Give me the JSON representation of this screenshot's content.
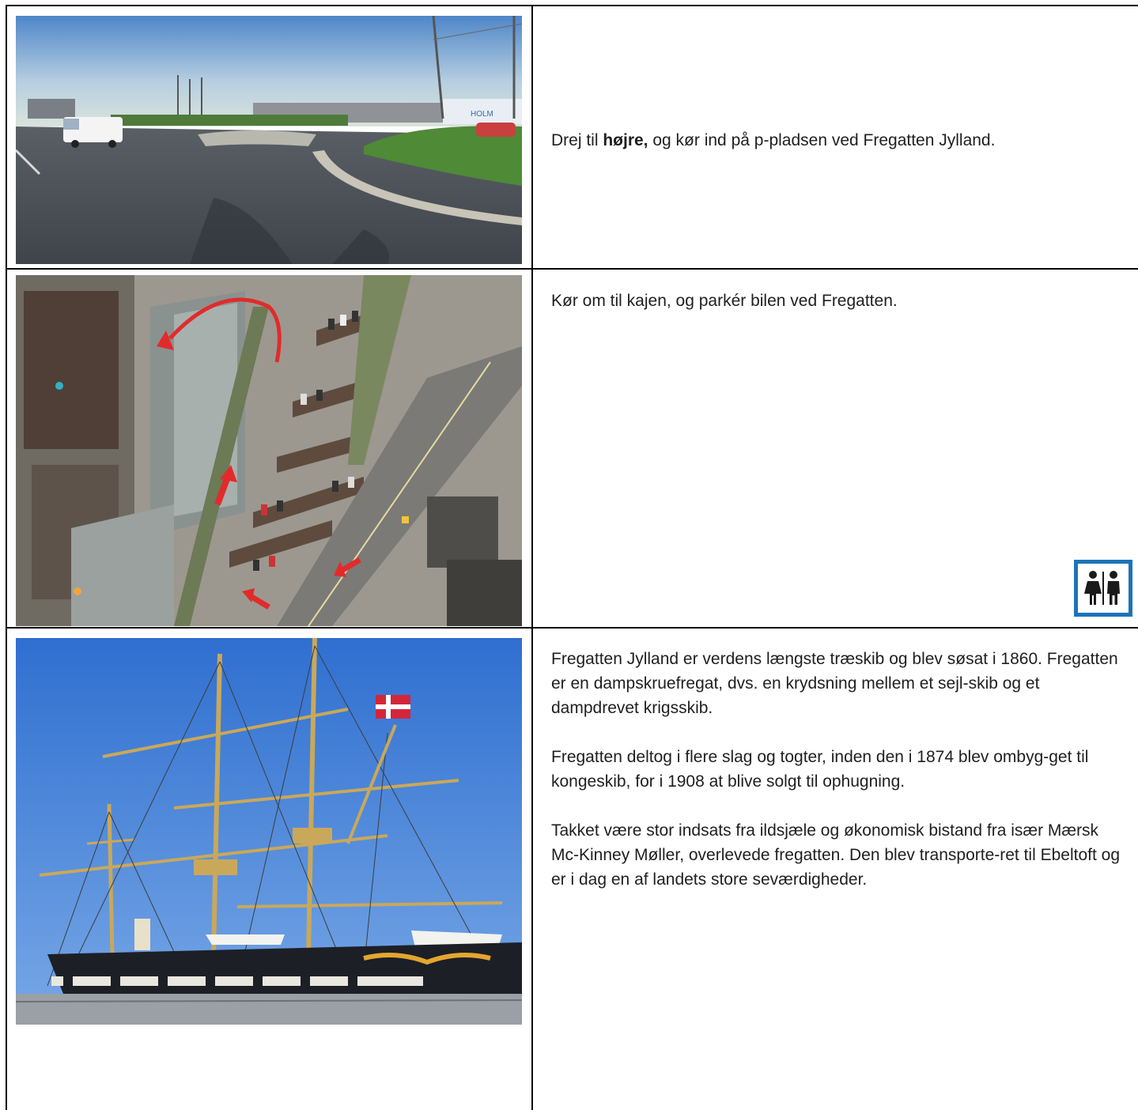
{
  "rows": [
    {
      "image": {
        "icon": "roundabout-street-photo"
      },
      "text": {
        "before": "Drej til ",
        "bold": "højre,",
        "after": " og kør ind på p-pladsen ved Fregatten Jylland."
      }
    },
    {
      "image": {
        "icon": "aerial-parking-map"
      },
      "text": {
        "paragraph": "Kør om til kajen, og parkér bilen ved Fregatten."
      },
      "badge": {
        "icon": "toilet-icon",
        "bg_color": "#1e73b9"
      }
    },
    {
      "image": {
        "icon": "frigate-jylland-photo"
      },
      "text": {
        "paragraphs": [
          "Fregatten Jylland er verdens længste træskib og blev søsat i 1860. Fregatten er en dampskruefregat, dvs. en krydsning mellem et sejl-skib og et dampdrevet krigsskib.",
          "Fregatten deltog i flere slag og togter, inden den i 1874 blev ombyg-get til kongeskib, for i 1908 at blive solgt til ophugning.",
          "Takket være stor indsats fra ildsjæle og økonomisk bistand fra især Mærsk Mc-Kinney Møller, overlevede fregatten. Den blev transporte-ret til Ebeltoft og er i dag en af landets store seværdigheder."
        ]
      }
    }
  ]
}
